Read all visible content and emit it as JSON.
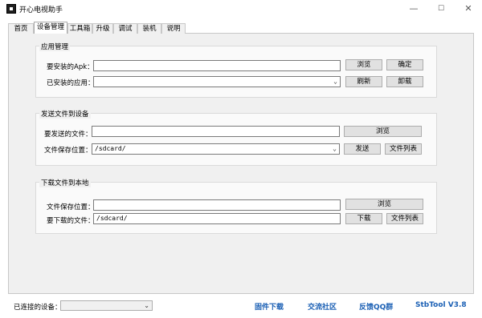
{
  "window": {
    "title": "开心电视助手",
    "minimize": "—",
    "maximize": "☐",
    "close": "✕"
  },
  "tabs": [
    "首页",
    "设备管理",
    "工具箱",
    "升级",
    "调试",
    "装机",
    "说明"
  ],
  "app_manage": {
    "title": "应用管理",
    "apk_label": "要安装的Apk：",
    "apk_value": "",
    "installed_label": "已安装的应用：",
    "installed_value": "",
    "browse": "浏览",
    "confirm": "确定",
    "refresh": "刷新",
    "uninstall": "卸载"
  },
  "send_file": {
    "title": "发送文件到设备",
    "file_label": "要发送的文件：",
    "file_value": "",
    "save_label": "文件保存位置：",
    "save_value": "/sdcard/",
    "browse": "浏览",
    "send": "发送",
    "file_list": "文件列表"
  },
  "download_file": {
    "title": "下载文件到本地",
    "save_label": "文件保存位置：",
    "save_value": "",
    "file_label": "要下载的文件：",
    "file_value": "/sdcard/",
    "browse": "浏览",
    "download": "下载",
    "file_list": "文件列表"
  },
  "status": {
    "connected_label": "已连接的设备：",
    "connected_value": "",
    "links": [
      "固件下载",
      "交流社区",
      "反馈QQ群",
      "StbTool V3.8"
    ]
  }
}
